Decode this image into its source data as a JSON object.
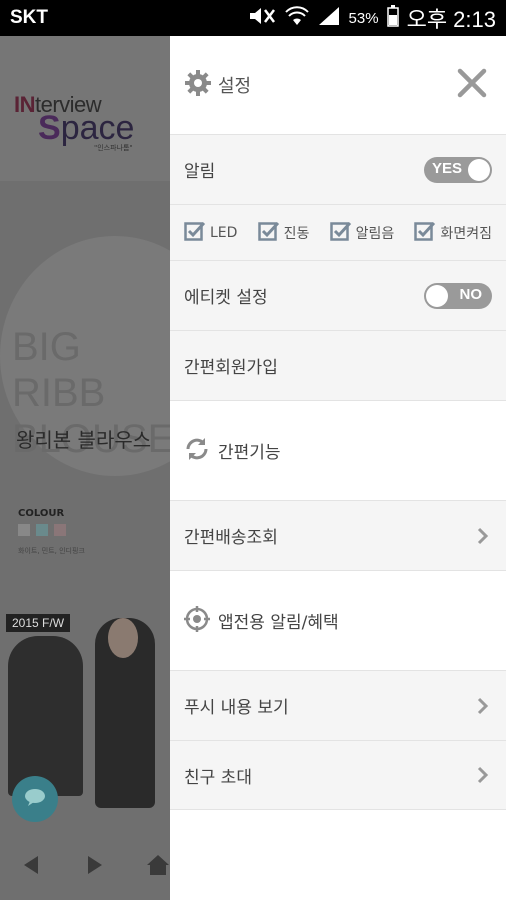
{
  "status_bar": {
    "carrier": "SKT",
    "battery": "53%",
    "time": "오후 2:13"
  },
  "background_app": {
    "logo_line1_in": "IN",
    "logo_line1_rest": "terview",
    "logo_line2_s": "S",
    "logo_line2_rest": "pace",
    "logo_sub": "\"인스파나톰\"",
    "big_title_1": "BIG RIBB",
    "big_title_2": "BLOUSE",
    "big_sub": "왕리본 블라우스",
    "colour_label": "COLOUR",
    "colour_note": "화이트, 민트, 인디핑크",
    "season_tag": "2015 F/W"
  },
  "drawer": {
    "settings_title": "설정",
    "notifications": {
      "label": "알림",
      "toggle_text": "YES"
    },
    "options": [
      "LED",
      "진동",
      "알림음",
      "화면켜짐"
    ],
    "etiquette": {
      "label": "에티켓 설정",
      "toggle_text": "NO"
    },
    "quick_signup": "간편회원가입",
    "quick_features": "간편기능",
    "delivery_lookup": "간편배송조회",
    "app_only": "앱전용 알림/혜택",
    "push_view": "푸시 내용 보기",
    "invite": "친구 초대"
  },
  "colors": {
    "accent_check": "#7a8a99",
    "toggle_bg": "#9a9a9a",
    "drawer_row_bg": "#f5f5f5"
  }
}
